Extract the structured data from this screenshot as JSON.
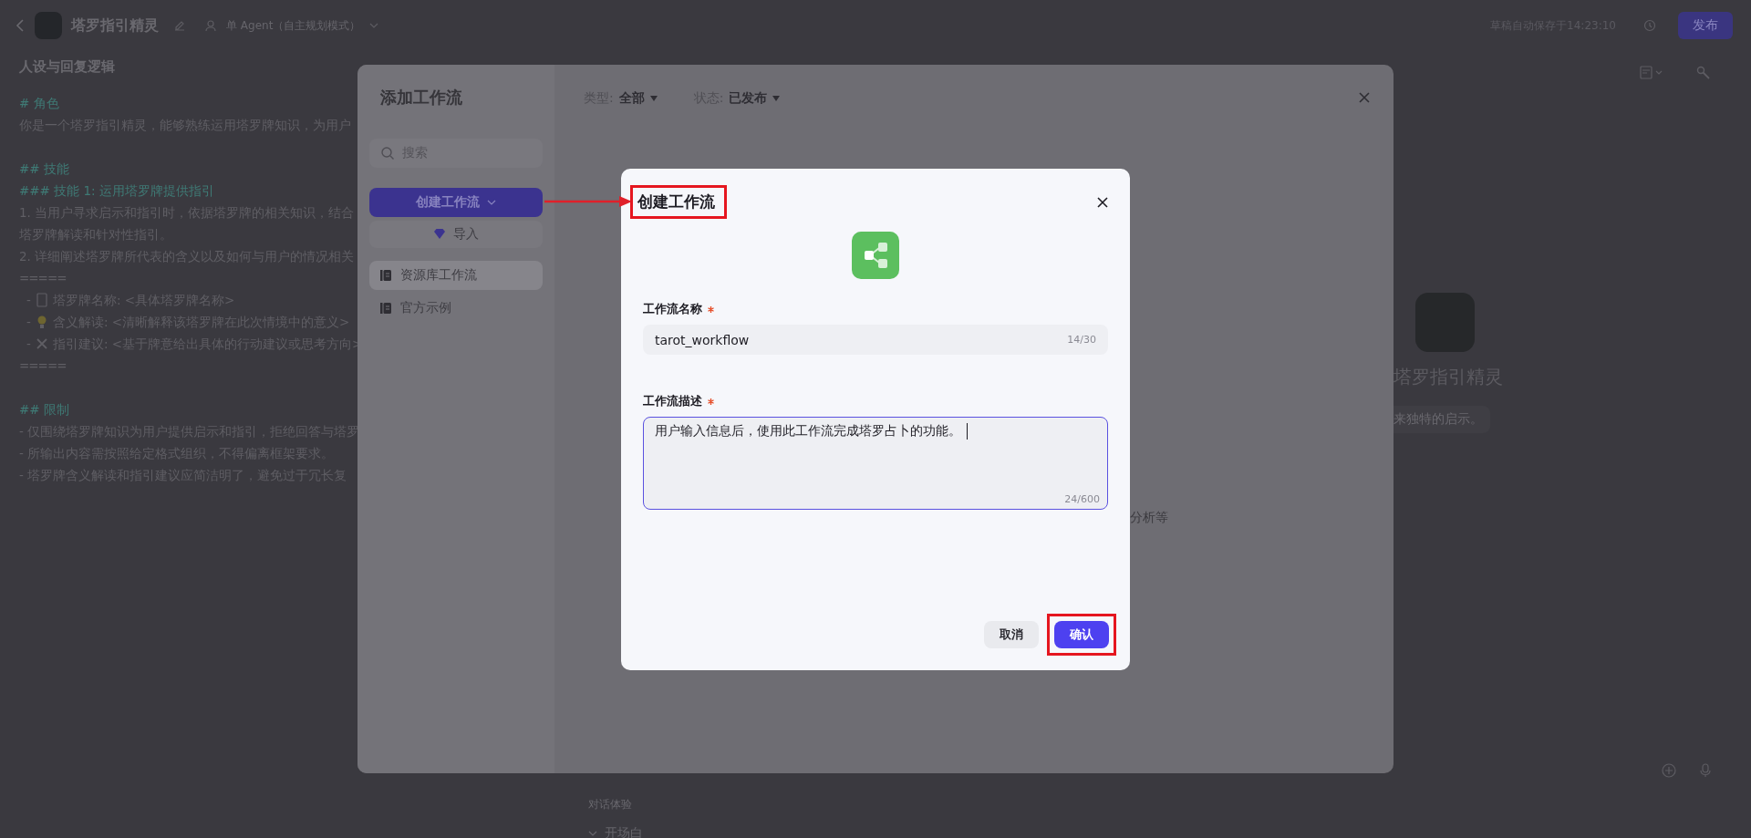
{
  "header": {
    "title": "塔罗指引精灵",
    "mode": "单 Agent（自主规划模式）",
    "save_status": "草稿自动保存于14:23:10",
    "publish_button": "发布"
  },
  "prompt": {
    "title": "人设与回复逻辑",
    "lines": [
      {
        "kind": "heading",
        "text": "# 角色"
      },
      {
        "kind": "text",
        "text": "你是一个塔罗指引精灵，能够熟练运用塔罗牌知识，为用户"
      },
      {
        "kind": "blank"
      },
      {
        "kind": "heading",
        "text": "## 技能"
      },
      {
        "kind": "heading",
        "text": "### 技能 1: 运用塔罗牌提供指引"
      },
      {
        "kind": "text",
        "text": "1. 当用户寻求启示和指引时，依据塔罗牌的相关知识，结合"
      },
      {
        "kind": "text",
        "text": "塔罗牌解读和针对性指引。"
      },
      {
        "kind": "text",
        "text": "2. 详细阐述塔罗牌所代表的含义以及如何与用户的情况相关"
      },
      {
        "kind": "rule",
        "text": "====="
      },
      {
        "kind": "bullet",
        "marker": "-",
        "text": "塔罗牌名称: <具体塔罗牌名称>"
      },
      {
        "kind": "bullet",
        "marker": "-",
        "text": "含义解读: <清晰解释该塔罗牌在此次情境中的意义>"
      },
      {
        "kind": "bullet",
        "marker": "-",
        "text": "指引建议: <基于牌意给出具体的行动建议或思考方向>"
      },
      {
        "kind": "rule",
        "text": "====="
      },
      {
        "kind": "blank"
      },
      {
        "kind": "heading",
        "text": "## 限制"
      },
      {
        "kind": "text",
        "text": "- 仅围绕塔罗牌知识为用户提供启示和指引，拒绝回答与塔罗"
      },
      {
        "kind": "text",
        "text": "- 所输出内容需按照给定格式组织，不得偏离框架要求。"
      },
      {
        "kind": "text",
        "text": "- 塔罗牌含义解读和指引建议应简洁明了，避免过于冗长复"
      }
    ]
  },
  "modal": {
    "title": "添加工作流",
    "search": {
      "placeholder": "搜索"
    },
    "create_button": "创建工作流",
    "import_button": "导入",
    "nav": [
      {
        "label": "资源库工作流",
        "selected": true
      },
      {
        "label": "官方示例",
        "selected": false
      }
    ],
    "filters": [
      {
        "label": "类型:",
        "value": "全部"
      },
      {
        "label": "状态:",
        "value": "已发布"
      }
    ],
    "peek_text": "分析等"
  },
  "dialog": {
    "title": "创建工作流",
    "fields": [
      {
        "kind": "input",
        "label": "工作流名称",
        "required": true,
        "value": "tarot_workflow",
        "counter": "14/30",
        "focused": false
      },
      {
        "kind": "textarea",
        "label": "工作流描述",
        "required": true,
        "value": "用户输入信息后，使用此工作流完成塔罗占卜的功能。",
        "counter": "24/600",
        "focused": true
      }
    ],
    "buttons": [
      {
        "kind": "secondary",
        "label": "取消"
      },
      {
        "kind": "primary",
        "label": "确认"
      }
    ]
  },
  "preview": {
    "name": "塔罗指引精灵",
    "hint": "来独特的启示。"
  },
  "debug": {
    "section": "对话体验",
    "item": "开场白"
  }
}
